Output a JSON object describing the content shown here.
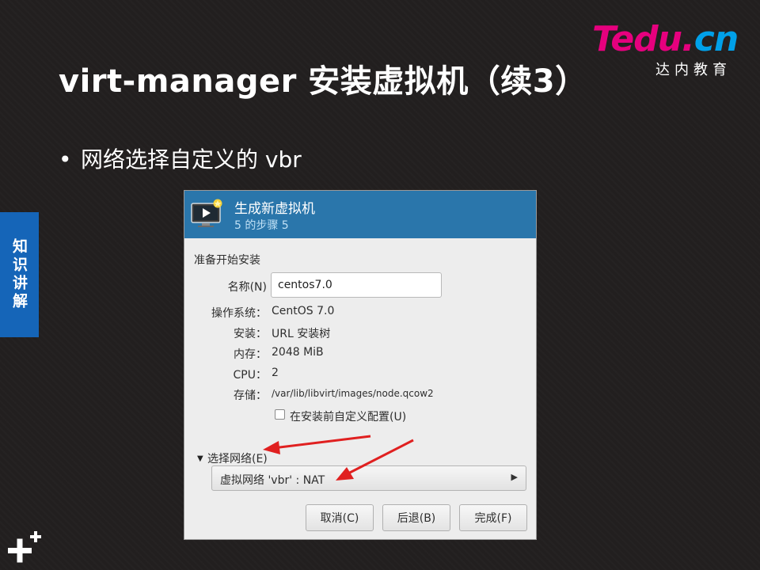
{
  "slide": {
    "title": "virt-manager 安装虚拟机（续3）",
    "bullet": "网络选择自定义的 vbr",
    "side_tab": "知识讲解"
  },
  "logo": {
    "text_t": "T",
    "text_edu": "edu.",
    "text_cn": "cn",
    "subtitle": "达内教育"
  },
  "dialog": {
    "title": "生成新虚拟机",
    "step": "5 的步骤 5",
    "section_label": "准备开始安装",
    "name_label": "名称(N)",
    "name_value": "centos7.0",
    "fields": [
      {
        "label": "操作系统：",
        "value": "CentOS 7.0"
      },
      {
        "label": "安装：",
        "value": "URL 安装树"
      },
      {
        "label": "内存：",
        "value": "2048 MiB"
      },
      {
        "label": "CPU：",
        "value": "2"
      },
      {
        "label": "存储：",
        "value": "/var/lib/libvirt/images/node.qcow2"
      }
    ],
    "customize_checkbox": "在安装前自定义配置(U)",
    "network_expander": "选择网络(E)",
    "network_selected": "虚拟网络 'vbr' : NAT",
    "buttons": {
      "cancel": "取消(C)",
      "back": "后退(B)",
      "finish": "完成(F)"
    }
  },
  "colors": {
    "header_blue": "#2a76ab",
    "side_tab_blue": "#1565b8",
    "arrow_red": "#e02020"
  }
}
